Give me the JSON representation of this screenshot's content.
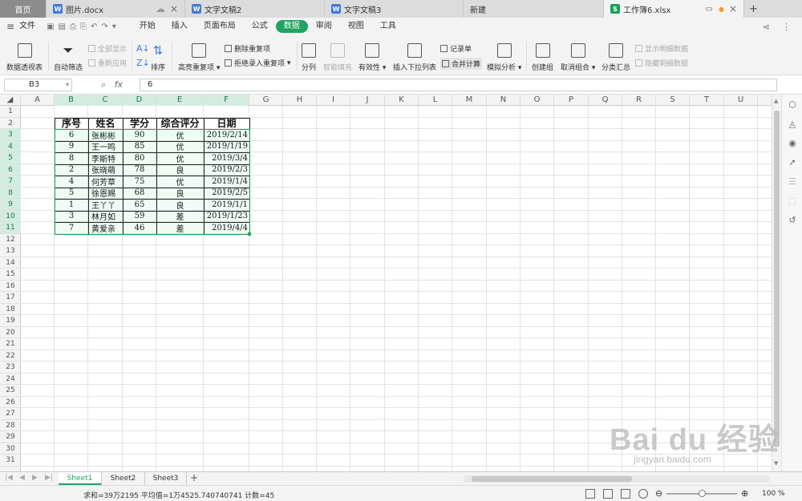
{
  "tabs": [
    {
      "label": "首页",
      "type": "home"
    },
    {
      "label": "图片.docx",
      "type": "w"
    },
    {
      "label": "文字文稿2",
      "type": "w"
    },
    {
      "label": "文字文稿3",
      "type": "w"
    },
    {
      "label": "新建",
      "type": "plain"
    },
    {
      "label": "工作簿6.xlsx",
      "type": "s",
      "active": true
    }
  ],
  "menu": {
    "file": "文件",
    "items": [
      "开始",
      "插入",
      "页面布局",
      "公式",
      "数据",
      "审阅",
      "视图",
      "工具"
    ],
    "active": "数据"
  },
  "ribbon": {
    "pivot": "数据透视表",
    "autofilter": "自动筛选",
    "show_all": "全部显示",
    "reapply": "重新应用",
    "sort": "排序",
    "highlight_dup": "高亮重复项",
    "delete_dup": "删除重复项",
    "reject_dup": "拒绝录入重复项",
    "split": "分列",
    "smart_fill": "智能填充",
    "validity": "有效性",
    "insert_dropdown": "插入下拉列表",
    "record": "记录单",
    "consolidate": "合并计算",
    "simulate": "模拟分析",
    "group": "创建组",
    "ungroup": "取消组合",
    "subtotal": "分类汇总",
    "show_detail": "显示明细数据",
    "hide_detail": "隐藏明细数据"
  },
  "formula_bar": {
    "cell_ref": "B3",
    "fx": "fx",
    "value": "6"
  },
  "columns": [
    "A",
    "B",
    "C",
    "D",
    "E",
    "F",
    "G",
    "H",
    "I",
    "J",
    "K",
    "L",
    "M",
    "N",
    "O",
    "P",
    "Q",
    "R",
    "S",
    "T",
    "U"
  ],
  "table": {
    "headers": [
      "序号",
      "姓名",
      "学分",
      "综合评分",
      "日期"
    ],
    "rows": [
      [
        "6",
        "张彬彬",
        "90",
        "优",
        "2019/2/14"
      ],
      [
        "9",
        "王一鸣",
        "85",
        "优",
        "2019/1/19"
      ],
      [
        "8",
        "李斯特",
        "80",
        "优",
        "2019/3/4"
      ],
      [
        "2",
        "张晓萌",
        "78",
        "良",
        "2019/2/3"
      ],
      [
        "4",
        "何芳草",
        "75",
        "优",
        "2019/1/4"
      ],
      [
        "5",
        "徐恩赐",
        "68",
        "良",
        "2019/2/5"
      ],
      [
        "1",
        "王丫丫",
        "65",
        "良",
        "2019/1/1"
      ],
      [
        "3",
        "林月如",
        "59",
        "差",
        "2019/1/23"
      ],
      [
        "7",
        "黄爱亲",
        "46",
        "差",
        "2019/4/4"
      ]
    ]
  },
  "sheets": [
    "Sheet1",
    "Sheet2",
    "Sheet3"
  ],
  "active_sheet": "Sheet1",
  "status": {
    "summary": "求和=39万2195  平均值=1万4525.740740741  计数=45",
    "zoom": "100 %"
  },
  "watermark": {
    "brand": "Bai du 经验",
    "url": "jingyan.baidu.com"
  }
}
